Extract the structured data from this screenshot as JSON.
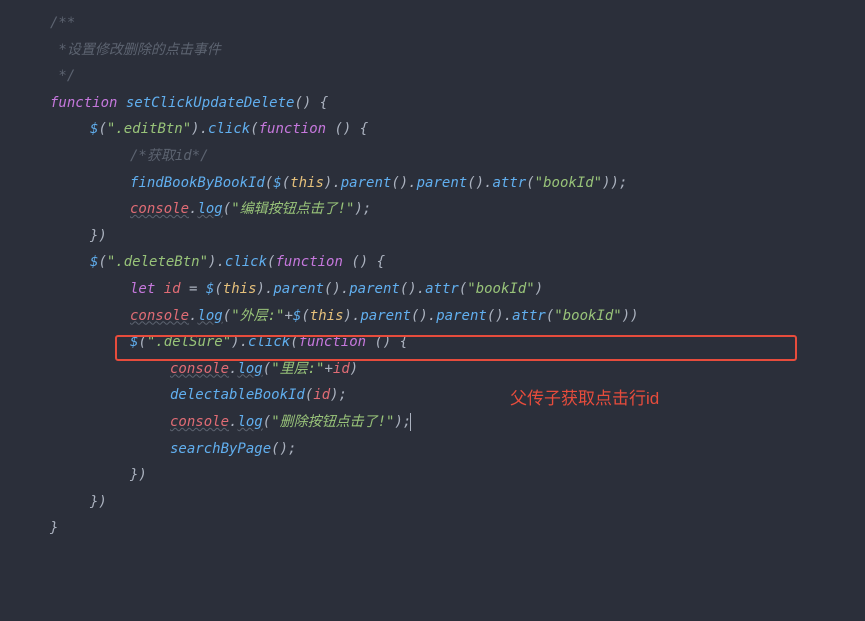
{
  "code": {
    "comment_start": "/**",
    "comment_line": " *设置修改删除的点击事件",
    "comment_end": " */",
    "fn_keyword": "function",
    "fn_name": "setClickUpdateDelete",
    "jq": "$",
    "sel_editBtn": "\".editBtn\"",
    "click": "click",
    "fn_inner": "function",
    "comment_getId": "/*获取id*/",
    "findBookByBookId": "findBookByBookId",
    "this": "this",
    "parent": "parent",
    "attr": "attr",
    "bookId_str": "\"bookId\"",
    "console": "console",
    "log": "log",
    "edit_log": "\"编辑按钮点击了!\"",
    "sel_deleteBtn": "\".deleteBtn\"",
    "let": "let",
    "id": "id",
    "outer_log": "\"外层:\"",
    "sel_delSure": "\".delSure\"",
    "inner_log": "\"里层:\"",
    "delectableBookId": "delectableBookId",
    "delete_log": "\"删除按钮点击了!\"",
    "searchByPage": "searchByPage"
  },
  "annotation": "父传子获取点击行id"
}
